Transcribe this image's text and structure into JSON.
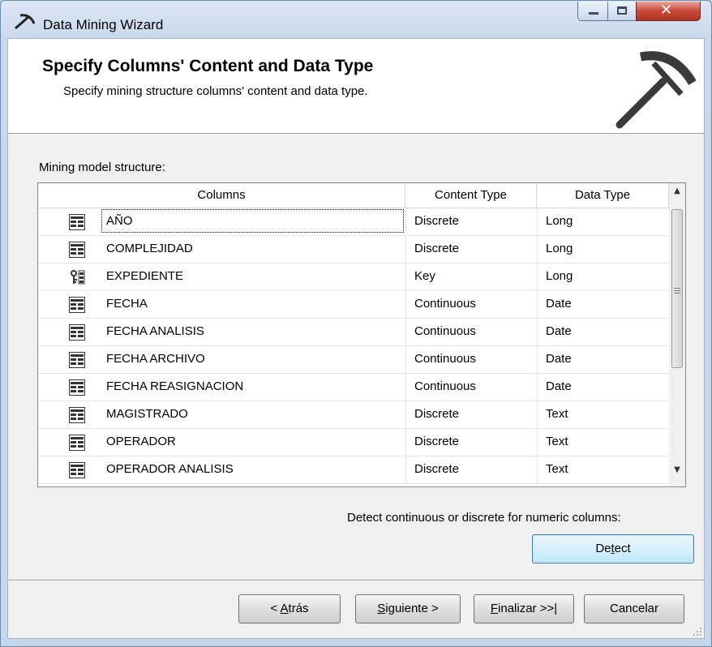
{
  "window": {
    "title": "Data Mining Wizard"
  },
  "header": {
    "title": "Specify Columns' Content and Data Type",
    "subtitle": "Specify mining structure columns' content and data type."
  },
  "structure_label": "Mining model structure:",
  "grid": {
    "headers": [
      "Columns",
      "Content Type",
      "Data Type"
    ],
    "rows": [
      {
        "icon": "column-icon",
        "column": "AÑO",
        "content_type": "Discrete",
        "data_type": "Long"
      },
      {
        "icon": "column-icon",
        "column": "COMPLEJIDAD",
        "content_type": "Discrete",
        "data_type": "Long"
      },
      {
        "icon": "key-icon",
        "column": "EXPEDIENTE",
        "content_type": "Key",
        "data_type": "Long"
      },
      {
        "icon": "column-icon",
        "column": "FECHA",
        "content_type": "Continuous",
        "data_type": "Date"
      },
      {
        "icon": "column-icon",
        "column": "FECHA ANALISIS",
        "content_type": "Continuous",
        "data_type": "Date"
      },
      {
        "icon": "column-icon",
        "column": "FECHA ARCHIVO",
        "content_type": "Continuous",
        "data_type": "Date"
      },
      {
        "icon": "column-icon",
        "column": "FECHA REASIGNACION",
        "content_type": "Continuous",
        "data_type": "Date"
      },
      {
        "icon": "column-icon",
        "column": "MAGISTRADO",
        "content_type": "Discrete",
        "data_type": "Text"
      },
      {
        "icon": "column-icon",
        "column": "OPERADOR",
        "content_type": "Discrete",
        "data_type": "Text"
      },
      {
        "icon": "column-icon",
        "column": "OPERADOR ANALISIS",
        "content_type": "Discrete",
        "data_type": "Text"
      }
    ]
  },
  "detect": {
    "label": "Detect continuous or discrete for numeric columns:",
    "button": "Detect"
  },
  "footer": {
    "back": "< Atrás",
    "next": "Siguiente >",
    "finish": "Finalizar >>|",
    "cancel": "Cancelar"
  },
  "colors": {
    "title_bar": "#c9d9ec",
    "close_button": "#c8493a",
    "default_button": "#bee6fd"
  }
}
